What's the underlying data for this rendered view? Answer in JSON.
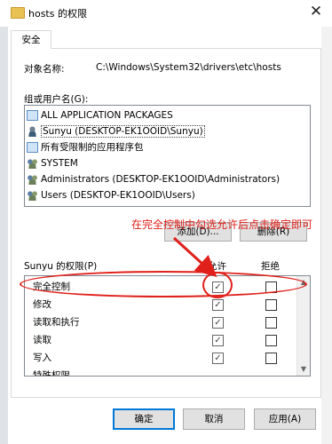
{
  "window": {
    "title": "hosts 的权限",
    "close_glyph": "✕"
  },
  "tabs": [
    {
      "label": "安全"
    }
  ],
  "object": {
    "label": "对象名称:",
    "value": "C:\\Windows\\System32\\drivers\\etc\\hosts"
  },
  "groups": {
    "label": "组或用户名(G):",
    "items": [
      {
        "label": "ALL APPLICATION PACKAGES",
        "icon": "package-icon"
      },
      {
        "label": "Sunyu (DESKTOP-EK1OOID\\Sunyu)",
        "icon": "user-icon",
        "selected": true
      },
      {
        "label": "所有受限制的应用程序包",
        "icon": "package-icon"
      },
      {
        "label": "SYSTEM",
        "icon": "group-icon"
      },
      {
        "label": "Administrators (DESKTOP-EK1OOID\\Administrators)",
        "icon": "group-icon"
      },
      {
        "label": "Users (DESKTOP-EK1OOID\\Users)",
        "icon": "group-icon"
      }
    ]
  },
  "buttons": {
    "add": "添加(D)...",
    "remove": "删除(R)",
    "ok": "确定",
    "cancel": "取消",
    "apply": "应用(A)"
  },
  "permissions": {
    "title": "Sunyu 的权限(P)",
    "allow_header": "允许",
    "deny_header": "拒绝",
    "rows": [
      {
        "label": "完全控制",
        "allow": true,
        "deny": false
      },
      {
        "label": "修改",
        "allow": true,
        "deny": false
      },
      {
        "label": "读取和执行",
        "allow": true,
        "deny": false
      },
      {
        "label": "读取",
        "allow": true,
        "deny": false
      },
      {
        "label": "写入",
        "allow": true,
        "deny": false
      },
      {
        "label": "特殊权限",
        "allow": false,
        "deny": false
      }
    ]
  },
  "annotation": {
    "text": "在完全控制中勾选允许后点击确定即可",
    "color": "#e0201a"
  },
  "colors": {
    "accent": "#0078d7"
  }
}
